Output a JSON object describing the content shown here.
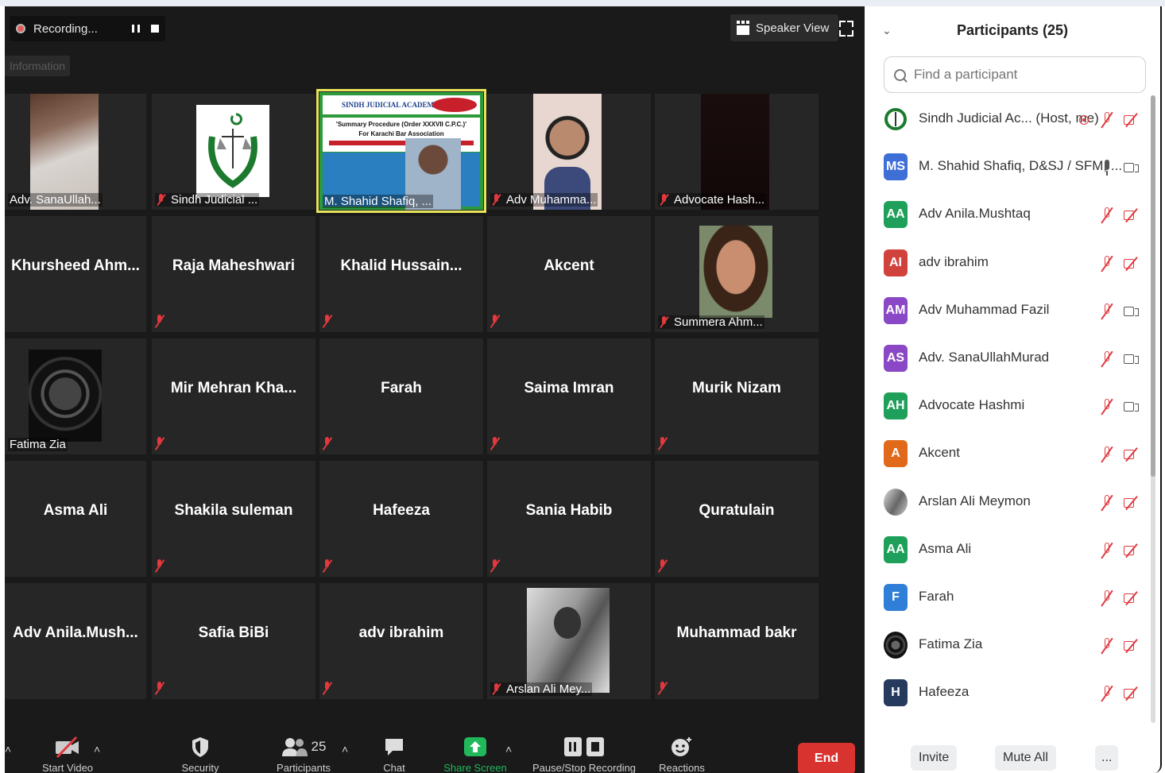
{
  "recording": {
    "label": "Recording..."
  },
  "info_label": "Information",
  "view_mode": {
    "label": "Speaker View"
  },
  "tiles": [
    {
      "name": "Adv. SanaUllah...",
      "type": "video"
    },
    {
      "name": "Sindh Judicial ...",
      "type": "logo",
      "muted": true
    },
    {
      "name": "M. Shahid Shafiq, ...",
      "type": "presenter",
      "active": true
    },
    {
      "name": "Adv Muhamma...",
      "type": "video",
      "muted": true
    },
    {
      "name": "Advocate Hash...",
      "type": "dark",
      "muted": true
    },
    {
      "name": "Khursheed  Ahm...",
      "type": "text"
    },
    {
      "name": "Raja Maheshwari",
      "type": "text",
      "muted": true
    },
    {
      "name": "Khalid  Hussain...",
      "type": "text",
      "muted": true
    },
    {
      "name": "Akcent",
      "type": "text",
      "muted": true
    },
    {
      "name": "Summera Ahm...",
      "type": "photo",
      "muted": true
    },
    {
      "name": "Fatima Zia",
      "type": "emblem"
    },
    {
      "name": "Mir  Mehran  Kha...",
      "type": "text",
      "muted": true
    },
    {
      "name": "Farah",
      "type": "text",
      "muted": true
    },
    {
      "name": "Saima Imran",
      "type": "text",
      "muted": true
    },
    {
      "name": "Murik Nizam",
      "type": "text",
      "muted": true
    },
    {
      "name": "Asma Ali",
      "type": "text"
    },
    {
      "name": "Shakila suleman",
      "type": "text",
      "muted": true
    },
    {
      "name": "Hafeeza",
      "type": "text",
      "muted": true
    },
    {
      "name": "Sania Habib",
      "type": "text",
      "muted": true
    },
    {
      "name": "Quratulain",
      "type": "text",
      "muted": true
    },
    {
      "name": "Adv  Anila.Mush...",
      "type": "text"
    },
    {
      "name": "Safia BiBi",
      "type": "text",
      "muted": true
    },
    {
      "name": "adv ibrahim",
      "type": "text",
      "muted": true
    },
    {
      "name": "Arslan Ali Mey...",
      "type": "bw",
      "muted": true
    },
    {
      "name": "Muhammad bakr",
      "type": "text",
      "muted": true
    }
  ],
  "presenter_slide": {
    "org": "SINDH JUDICIAL ACADEMY",
    "title": "'Summary Procedure (Order XXXVII C.P.C.)'",
    "subtitle": "For Karachi Bar Association"
  },
  "toolbar": {
    "start_video": "Start Video",
    "security": "Security",
    "participants": "Participants",
    "participants_count": "25",
    "chat": "Chat",
    "share_screen": "Share Screen",
    "pause_recording": "Pause/Stop Recording",
    "reactions": "Reactions",
    "end": "End"
  },
  "panel": {
    "title": "Participants (25)",
    "search_placeholder": "Find a participant",
    "invite": "Invite",
    "mute_all": "Mute All",
    "more": "...",
    "participants": [
      {
        "initials": "",
        "name": "Sindh Judicial Ac... (Host, me)",
        "color": "#ffffff",
        "mic": "off",
        "cam": "off",
        "recording": true
      },
      {
        "initials": "MS",
        "name": "M. Shahid Shafiq, D&SJ / SFM, ...",
        "color": "#3d6fd6",
        "mic": "on",
        "cam": "on"
      },
      {
        "initials": "AA",
        "name": "Adv Anila.Mushtaq",
        "color": "#1fa05a",
        "mic": "off",
        "cam": "off"
      },
      {
        "initials": "AI",
        "name": "adv ibrahim",
        "color": "#d2423c",
        "mic": "off",
        "cam": "off"
      },
      {
        "initials": "AM",
        "name": "Adv Muhammad Fazil",
        "color": "#8a48c7",
        "mic": "off",
        "cam": "on"
      },
      {
        "initials": "AS",
        "name": "Adv. SanaUllahMurad",
        "color": "#8a48c7",
        "mic": "off",
        "cam": "on"
      },
      {
        "initials": "AH",
        "name": "Advocate Hashmi",
        "color": "#1fa05a",
        "mic": "off",
        "cam": "on"
      },
      {
        "initials": "A",
        "name": "Akcent",
        "color": "#e06a1a",
        "mic": "off",
        "cam": "off"
      },
      {
        "initials": "",
        "name": "Arslan Ali Meymon",
        "color": "#777777",
        "mic": "off",
        "cam": "off"
      },
      {
        "initials": "AA",
        "name": "Asma Ali",
        "color": "#1fa05a",
        "mic": "off",
        "cam": "off"
      },
      {
        "initials": "F",
        "name": "Farah",
        "color": "#2f7fd8",
        "mic": "off",
        "cam": "off"
      },
      {
        "initials": "",
        "name": "Fatima Zia",
        "color": "#2a2a2a",
        "mic": "off",
        "cam": "off"
      },
      {
        "initials": "H",
        "name": "Hafeeza",
        "color": "#263a5e",
        "mic": "off",
        "cam": "off"
      }
    ]
  }
}
